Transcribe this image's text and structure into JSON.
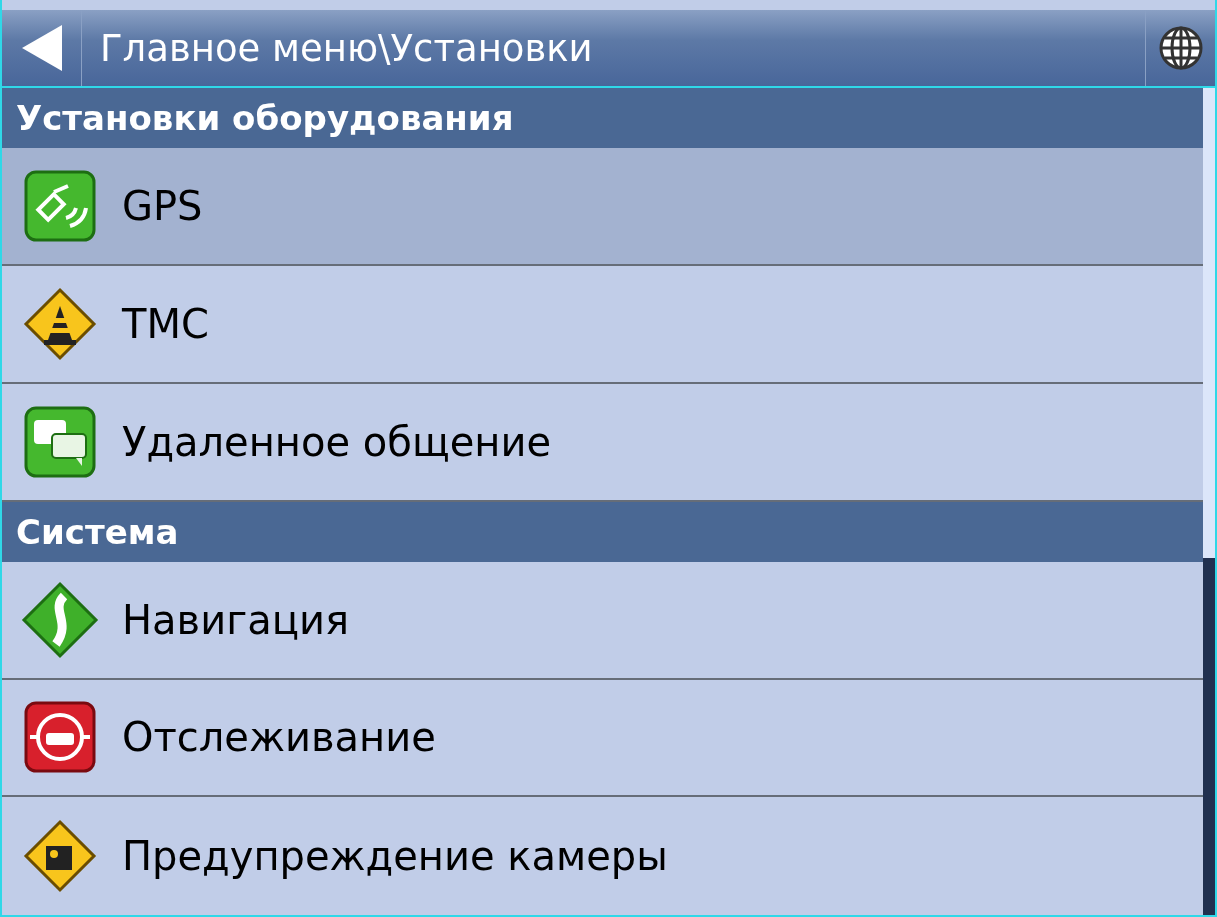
{
  "title_bar": {
    "title": "Главное меню\\Установки"
  },
  "sections": [
    {
      "heading": "Установки оборудования",
      "items": [
        {
          "label": "GPS",
          "selected": true
        },
        {
          "label": "TMC",
          "selected": false
        },
        {
          "label": "Удаленное общение",
          "selected": false
        }
      ]
    },
    {
      "heading": "Система",
      "items": [
        {
          "label": "Навигация",
          "selected": false
        },
        {
          "label": "Отслеживание",
          "selected": false
        },
        {
          "label": "Предупреждение камеры",
          "selected": false
        }
      ]
    }
  ]
}
